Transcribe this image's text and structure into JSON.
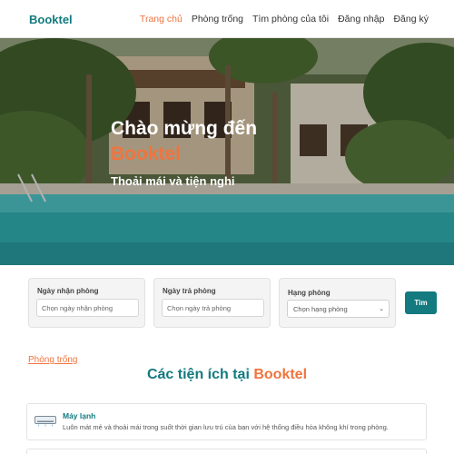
{
  "nav": {
    "brand": "Booktel",
    "links": [
      {
        "label": "Trang chủ",
        "active": true
      },
      {
        "label": "Phòng trống",
        "active": false
      },
      {
        "label": "Tìm phòng của tôi",
        "active": false
      },
      {
        "label": "Đăng nhập",
        "active": false
      },
      {
        "label": "Đăng ký",
        "active": false
      }
    ]
  },
  "hero": {
    "title_line1": "Chào mừng đến",
    "brand": "Booktel",
    "subtitle": "Thoải mái và tiện nghi"
  },
  "search": {
    "checkin_label": "Ngày nhận phòng",
    "checkin_placeholder": "Chọn ngày nhận phòng",
    "checkout_label": "Ngày trả phòng",
    "checkout_placeholder": "Chọn ngày trả phòng",
    "class_label": "Hạng phòng",
    "class_value": "Chọn hạng phòng",
    "button": "Tìm"
  },
  "rooms_link": "Phòng trống",
  "amenities": {
    "heading_prefix": "Các tiện ích tại",
    "heading_brand": "Booktel",
    "items": [
      {
        "title": "Máy lạnh",
        "description": "Luôn mát mẻ và thoải mái trong suốt thời gian lưu trú của bạn với hệ thống điều hòa không khí trong phòng.",
        "icon": "air-conditioner-icon"
      }
    ]
  },
  "colors": {
    "brand": "#137a7f",
    "accent": "#f0743e"
  }
}
